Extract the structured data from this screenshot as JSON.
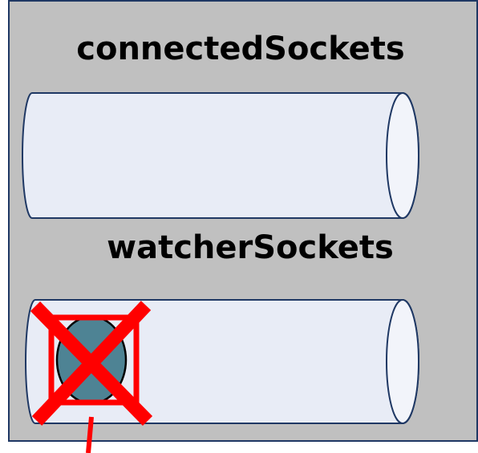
{
  "panel": {
    "background": "#c0c0c0",
    "border": "#1f3864"
  },
  "labels": {
    "top_queue": "connectedSockets",
    "bottom_queue": "watcherSockets"
  },
  "queue_style": {
    "fill": "#e8ecf6",
    "end_cap_fill": "#f2f4fa",
    "stroke": "#1f3864"
  },
  "socket_item": {
    "fill": "#4e8394",
    "stroke": "#000000"
  },
  "removal_mark": {
    "color": "#ff0000"
  },
  "connector": {
    "color": "#ff0000"
  }
}
